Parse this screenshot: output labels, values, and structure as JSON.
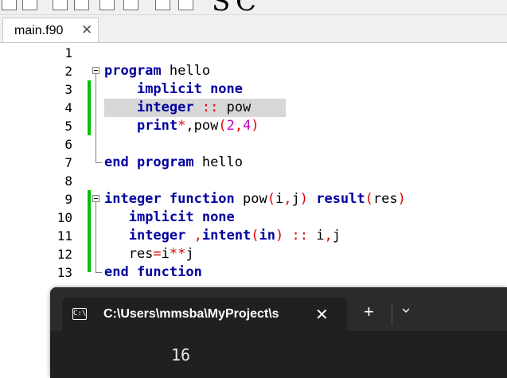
{
  "editor": {
    "tab_label": "main.f90",
    "tab_close": "✕",
    "line_numbers": [
      "1",
      "2",
      "3",
      "4",
      "5",
      "6",
      "7",
      "8",
      "9",
      "10",
      "11",
      "12",
      "13"
    ],
    "lines": [
      [],
      [
        {
          "t": "program",
          "c": "kw"
        },
        {
          "t": " hello",
          "c": ""
        }
      ],
      [
        {
          "t": "    ",
          "c": ""
        },
        {
          "t": "implicit none",
          "c": "kw"
        }
      ],
      [
        {
          "t": "    ",
          "c": ""
        },
        {
          "t": "integer",
          "c": "kw"
        },
        {
          "t": " ",
          "c": ""
        },
        {
          "t": "::",
          "c": "op"
        },
        {
          "t": " pow",
          "c": ""
        }
      ],
      [
        {
          "t": "    ",
          "c": ""
        },
        {
          "t": "print",
          "c": "kw"
        },
        {
          "t": "*",
          "c": "op"
        },
        {
          "t": ",pow",
          "c": ""
        },
        {
          "t": "(",
          "c": "op"
        },
        {
          "t": "2",
          "c": "num"
        },
        {
          "t": ",",
          "c": "op"
        },
        {
          "t": "4",
          "c": "num"
        },
        {
          "t": ")",
          "c": "op"
        }
      ],
      [],
      [
        {
          "t": "end program",
          "c": "kw"
        },
        {
          "t": " hello",
          "c": ""
        }
      ],
      [],
      [
        {
          "t": "integer function",
          "c": "kw"
        },
        {
          "t": " pow",
          "c": ""
        },
        {
          "t": "(",
          "c": "op"
        },
        {
          "t": "i",
          "c": ""
        },
        {
          "t": ",",
          "c": "op"
        },
        {
          "t": "j",
          "c": ""
        },
        {
          "t": ")",
          "c": "op"
        },
        {
          "t": " ",
          "c": ""
        },
        {
          "t": "result",
          "c": "kw"
        },
        {
          "t": "(",
          "c": "op"
        },
        {
          "t": "res",
          "c": ""
        },
        {
          "t": ")",
          "c": "op"
        }
      ],
      [
        {
          "t": "   ",
          "c": ""
        },
        {
          "t": "implicit none",
          "c": "kw"
        }
      ],
      [
        {
          "t": "   ",
          "c": ""
        },
        {
          "t": "integer",
          "c": "kw"
        },
        {
          "t": " ",
          "c": ""
        },
        {
          "t": ",",
          "c": "op"
        },
        {
          "t": "intent",
          "c": "kw"
        },
        {
          "t": "(",
          "c": "op"
        },
        {
          "t": "in",
          "c": "kw"
        },
        {
          "t": ")",
          "c": "op"
        },
        {
          "t": " ",
          "c": ""
        },
        {
          "t": "::",
          "c": "op"
        },
        {
          "t": " i",
          "c": ""
        },
        {
          "t": ",",
          "c": "op"
        },
        {
          "t": "j",
          "c": ""
        }
      ],
      [
        {
          "t": "   res",
          "c": ""
        },
        {
          "t": "=",
          "c": "op"
        },
        {
          "t": "i",
          "c": ""
        },
        {
          "t": "**",
          "c": "op"
        },
        {
          "t": "j",
          "c": ""
        }
      ],
      [
        {
          "t": "end function",
          "c": "kw"
        }
      ]
    ],
    "highlight_line": 4,
    "change_bar_color": "#00c000",
    "keyword_color": "#0000a0",
    "operator_color": "#e00000",
    "number_color": "#c000c0"
  },
  "toolbar": {
    "glyphs": [
      "S",
      "C"
    ],
    "icons": [
      "box-icon",
      "box-icon",
      "box-icon",
      "box-icon",
      "box-icon",
      "zoom-in-icon",
      "zoom-out-icon"
    ]
  },
  "terminal": {
    "tab_icon": "C:\\",
    "tab_title": "C:\\Users\\mmsba\\MyProject\\s",
    "close": "✕",
    "new_tab": "+",
    "output": "16",
    "background": "#202020"
  }
}
